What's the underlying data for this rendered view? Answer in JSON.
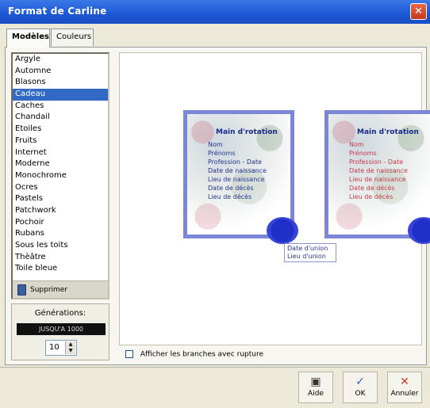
{
  "window": {
    "title": "Format de Carline",
    "close_glyph": "✕"
  },
  "tabs": [
    {
      "label": "Modèles"
    },
    {
      "label": "Couleurs"
    }
  ],
  "models_list": {
    "items": [
      "Argyle",
      "Automne",
      "Blasons",
      "Cadeau",
      "Caches",
      "Chandail",
      "Etoiles",
      "Fruits",
      "Internet",
      "Moderne",
      "Monochrome",
      "Ocres",
      "Pastels",
      "Patchwork",
      "Pochoir",
      "Rubans",
      "Sous les toits",
      "Thèâtre",
      "Toile bleue"
    ],
    "selected_index": 3,
    "delete_label": "Supprimer"
  },
  "generations": {
    "label": "Générations:",
    "field_value": "JUSQU'A 1000",
    "spin_value": "10"
  },
  "preview": {
    "cards": [
      {
        "title": "Main d'rotation",
        "lines": [
          "Nom",
          "Prénoms",
          "Profession - Date",
          "Date de naissance",
          "Lieu de naissance",
          "Date de décès",
          "Lieu de décès"
        ]
      },
      {
        "title": "Main d'rotation",
        "lines": [
          "Nom",
          "Prénoms",
          "Profession - Date",
          "Date de naissance",
          "Lieu de naissance",
          "Date de décès",
          "Lieu de décès"
        ]
      }
    ],
    "annotation": [
      "Date d'union",
      "Lieu d'union"
    ]
  },
  "options": {
    "checkbox_label": "Afficher les branches avec rupture",
    "checked": false
  },
  "buttons": {
    "help": {
      "label": "Aide",
      "icon": "help-icon"
    },
    "ok": {
      "label": "OK",
      "icon": "check-icon"
    },
    "cancel": {
      "label": "Annuler",
      "icon": "cancel-icon"
    }
  }
}
